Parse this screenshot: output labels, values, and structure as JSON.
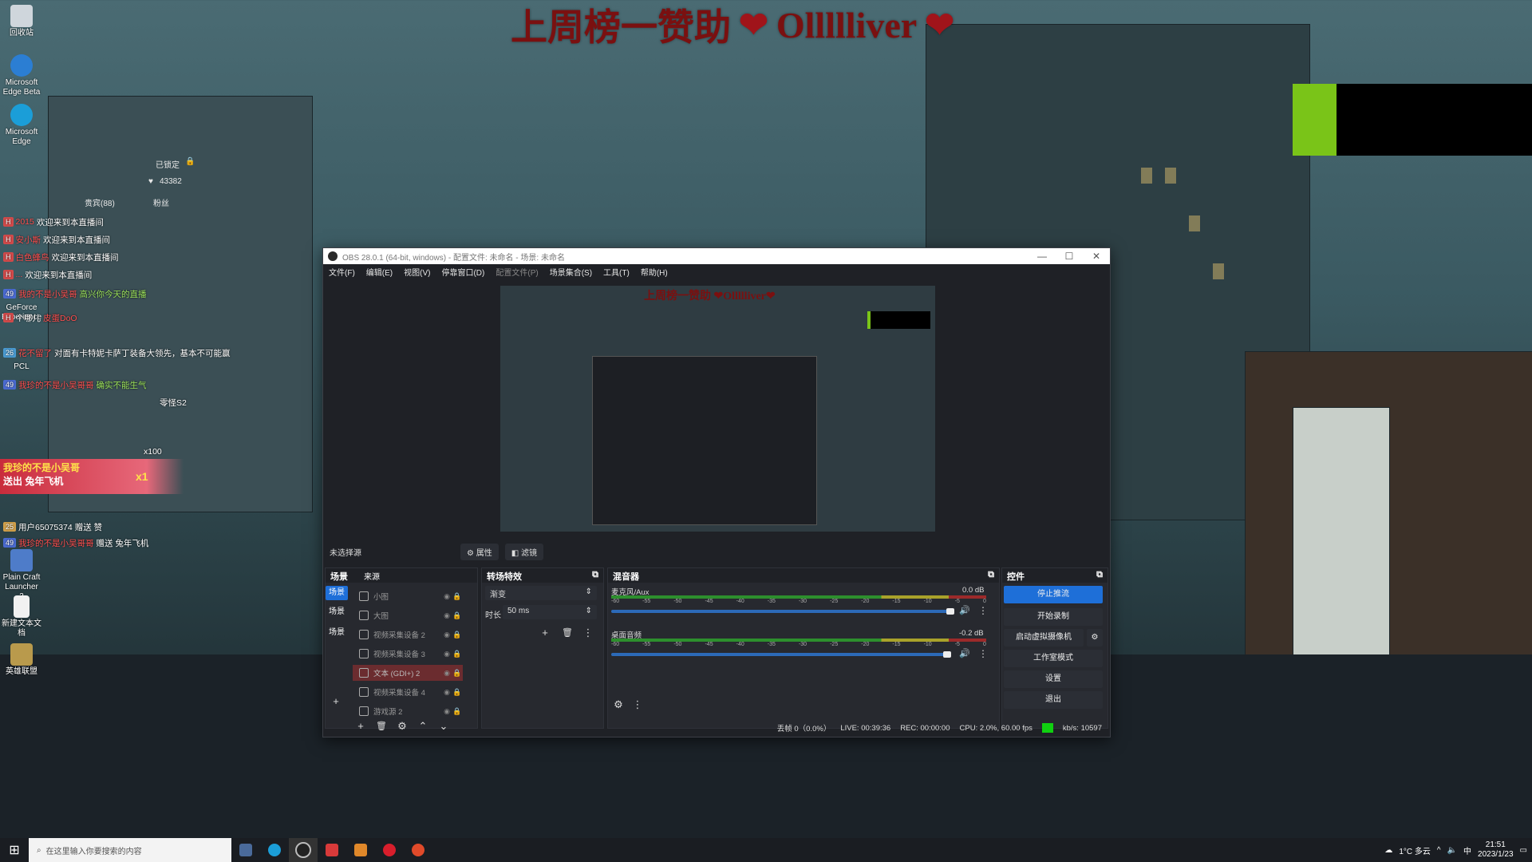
{
  "overlay": {
    "title": "上周榜一赞助",
    "name": "Ollllliver",
    "heart": "❤"
  },
  "desktop_icons": [
    {
      "label": "回收站"
    },
    {
      "label": "Microsoft Edge Beta"
    },
    {
      "label": "Microsoft Edge"
    },
    {
      "label": "GeForce Experience"
    },
    {
      "label": "PCL"
    },
    {
      "label": "Plain Craft Launcher 2"
    },
    {
      "label": "新建文本文档"
    },
    {
      "label": "英雄联盟"
    }
  ],
  "chat": {
    "locked": "已锁定",
    "count": "43382",
    "online_label": "贵宾(88)",
    "fans_label": "粉丝",
    "lines": [
      {
        "user": "2015",
        "text": "欢迎来到本直播间"
      },
      {
        "user": "安小斯",
        "text": "欢迎来到本直播间"
      },
      {
        "user": "白色蜂鸟",
        "text": "欢迎来到本直播间"
      },
      {
        "user": "...",
        "text": "欢迎来到本直播间"
      },
      {
        "user": "我的不是小吴哥",
        "text": "高兴你今天的直播"
      },
      {
        "user": "个哪儿",
        "text": "皮蛋DoO"
      },
      {
        "user": "花不留了",
        "text": "对面有卡特妮卡萨丁装备大领先，基本不可能赢"
      },
      {
        "user": "我珍的不是小吴哥哥",
        "text": "确实不能生气"
      },
      {
        "user": "",
        "text": "零怪S2"
      },
      {
        "user": "",
        "text": "x100"
      },
      {
        "user": "用户65075374",
        "text": "赠送 赞"
      },
      {
        "user": "我珍的不是小吴哥哥",
        "text": "赠送 兔年飞机"
      }
    ],
    "gift_banner": {
      "user": "我珍的不是小吴哥",
      "gift": "送出 兔年飞机",
      "count": "x1"
    },
    "x10": "x10"
  },
  "obs": {
    "window_title": "OBS 28.0.1 (64-bit, windows) - 配置文件: 未命名 - 场景: 未命名",
    "menu": [
      "文件(F)",
      "编辑(E)",
      "视图(V)",
      "停靠窗口(D)",
      "配置文件(P)",
      "场景集合(S)",
      "工具(T)",
      "帮助(H)"
    ],
    "preview_title": "上周榜一赞助 ❤Ollllliver❤",
    "no_source": "未选择源",
    "properties_btn": "属性",
    "filters_btn": "滤镜",
    "scenes": {
      "title": "场景",
      "items": [
        "场景",
        "场景",
        "场景"
      ]
    },
    "sources": {
      "title": "来源",
      "items": [
        {
          "name": "小图"
        },
        {
          "name": "大图"
        },
        {
          "name": "视频采集设备 2"
        },
        {
          "name": "视频采集设备 3"
        },
        {
          "name": "文本 (GDI+) 2"
        },
        {
          "name": "视频采集设备 4"
        },
        {
          "name": "游戏源 2"
        }
      ]
    },
    "transitions": {
      "title": "转场特效",
      "type": "渐变",
      "duration_label": "时长",
      "duration": "50 ms"
    },
    "mixer": {
      "title": "混音器",
      "ticks": [
        "-60",
        "-55",
        "-50",
        "-45",
        "-40",
        "-35",
        "-30",
        "-25",
        "-20",
        "-15",
        "-10",
        "-5",
        "0"
      ],
      "tracks": [
        {
          "name": "麦克风/Aux",
          "db": "0.0 dB"
        },
        {
          "name": "桌面音频",
          "db": "-0.2 dB"
        }
      ]
    },
    "controls": {
      "title": "控件",
      "stop_stream": "停止推流",
      "start_record": "开始录制",
      "virtual_cam": "启动虚拟摄像机",
      "studio_mode": "工作室模式",
      "settings": "设置",
      "exit": "退出"
    },
    "status": {
      "dropped": "丢帧 0（0.0%）",
      "live": "LIVE: 00:39:36",
      "rec": "REC: 00:00:00",
      "cpu": "CPU: 2.0%, 60.00 fps",
      "kbps": "kb/s: 10597"
    }
  },
  "taskbar": {
    "search_placeholder": "在这里输入你要搜索的内容",
    "weather": "1°C 多云",
    "ime": "中",
    "time": "21:51",
    "date": "2023/1/23"
  },
  "colors": {
    "accent": "#1e6fd8",
    "live_green": "#10d010",
    "overlay_red": "#7a1010",
    "overlay_green": "#7ac418"
  }
}
